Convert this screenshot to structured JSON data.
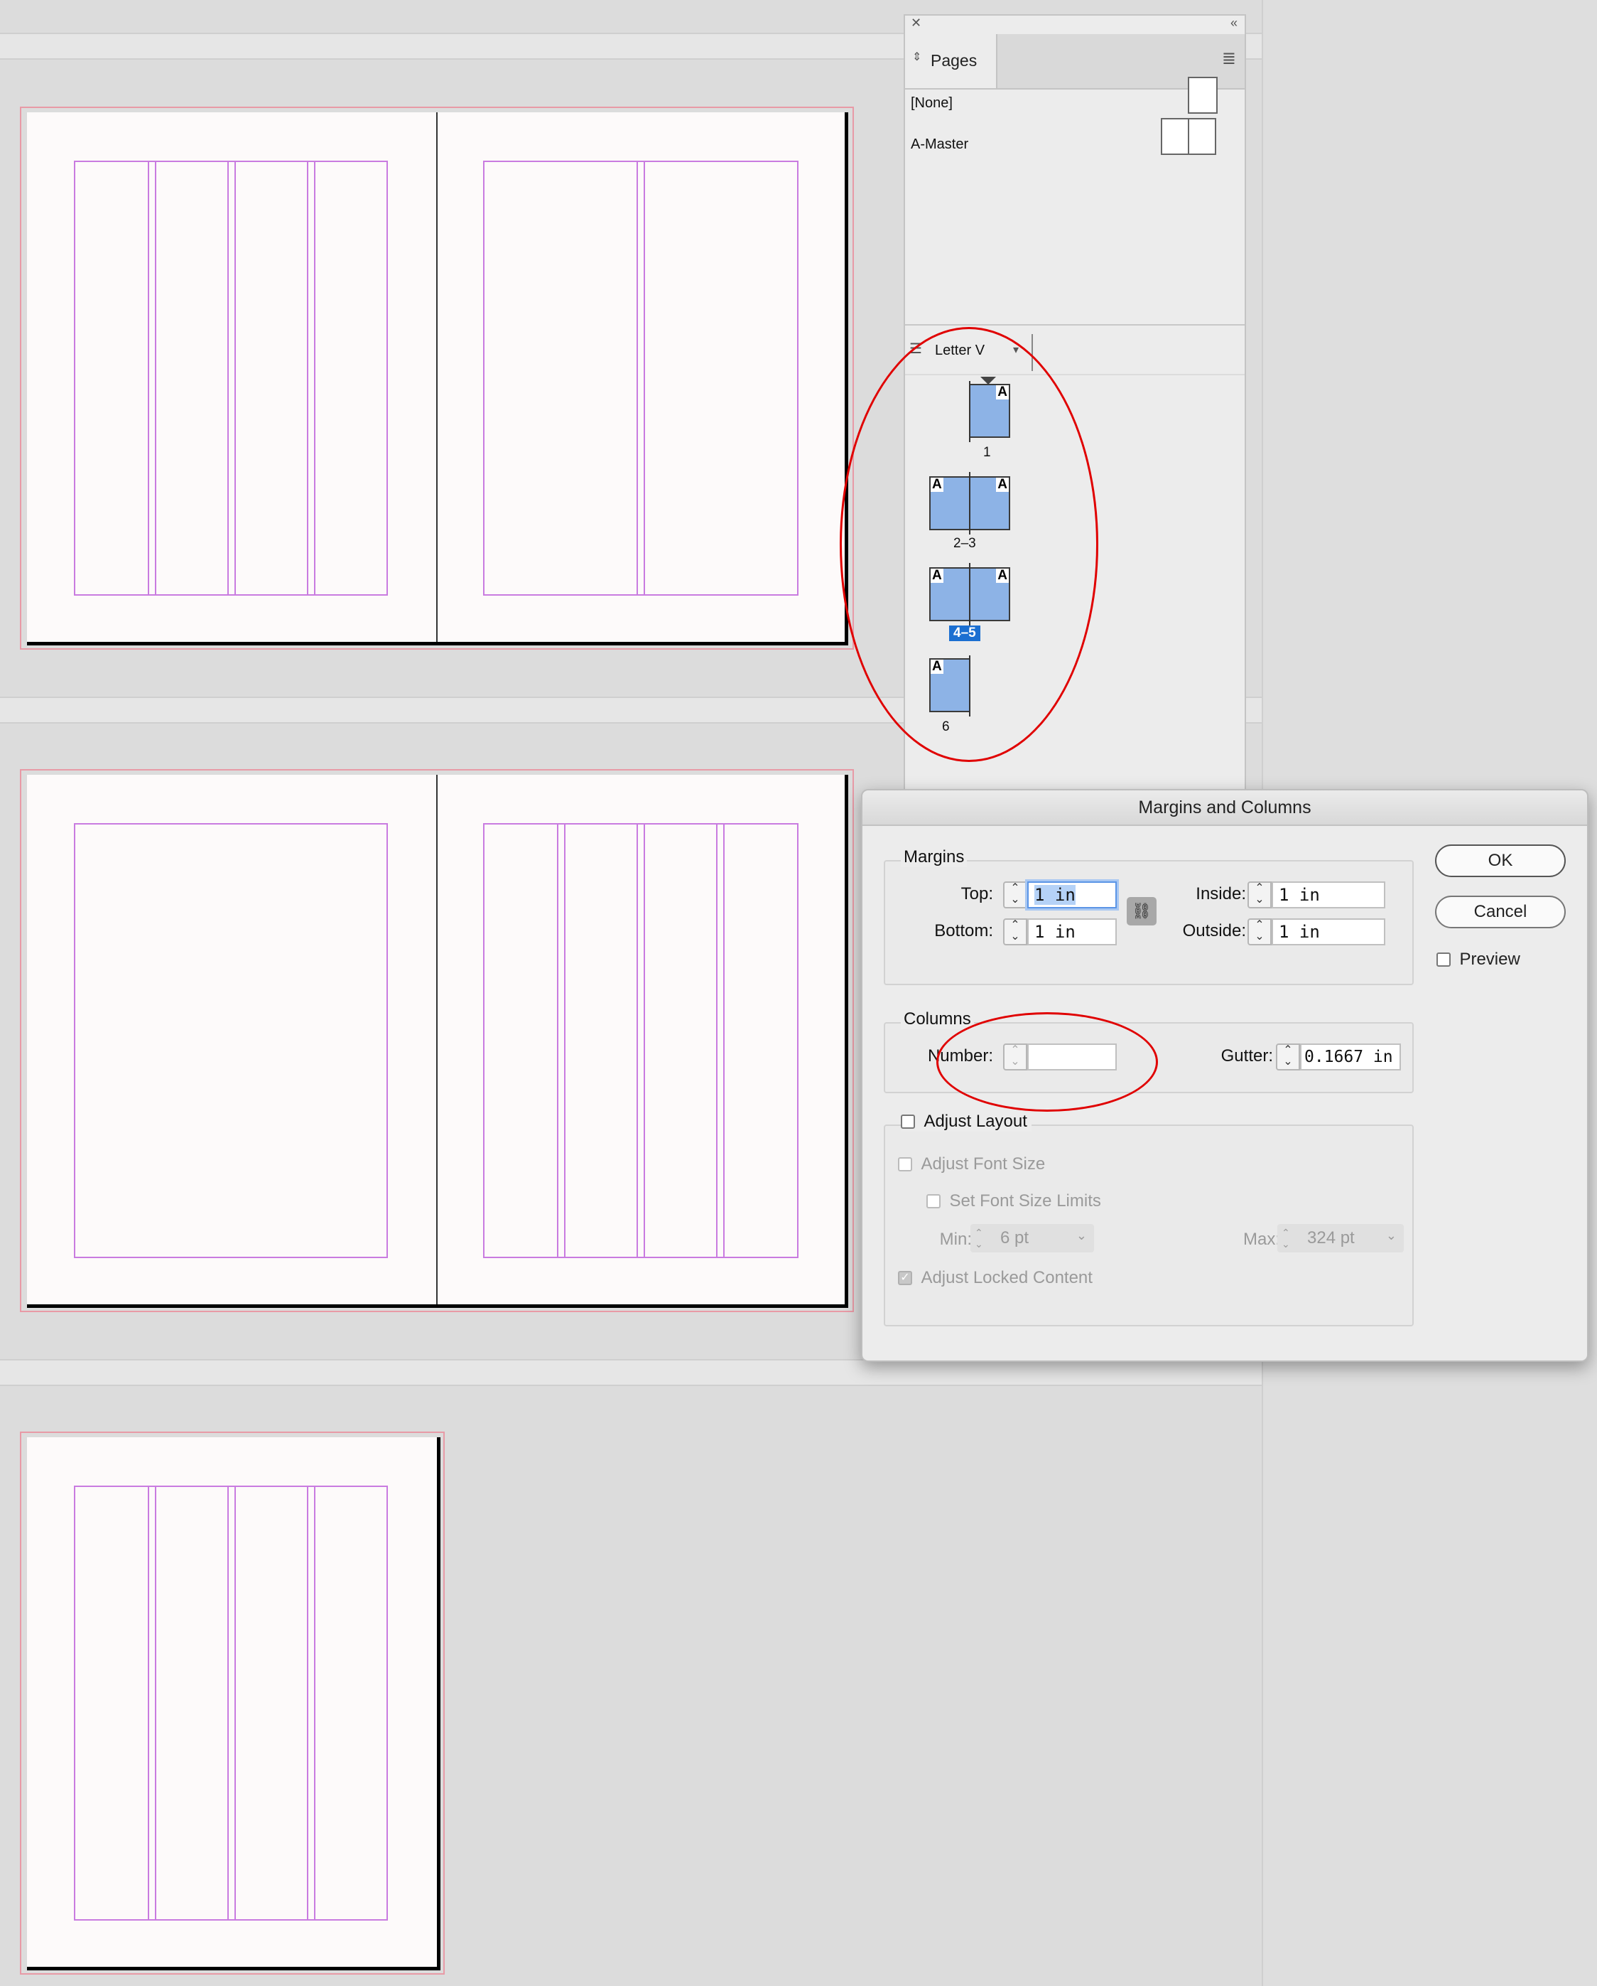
{
  "pages_panel": {
    "tab_label": "Pages",
    "masters": [
      {
        "label": "[None]"
      },
      {
        "label": "A-Master"
      }
    ],
    "page_size_label": "Letter V",
    "master_prefix": "A",
    "page_groups": [
      {
        "label": "1"
      },
      {
        "label": "2–3"
      },
      {
        "label": "4–5",
        "selected": true
      },
      {
        "label": "6"
      }
    ]
  },
  "dialog": {
    "title": "Margins and Columns",
    "margins_label": "Margins",
    "top_label": "Top:",
    "top_value": "1 in",
    "bottom_label": "Bottom:",
    "bottom_value": "1 in",
    "inside_label": "Inside:",
    "inside_value": "1 in",
    "outside_label": "Outside:",
    "outside_value": "1 in",
    "columns_label": "Columns",
    "number_label": "Number:",
    "number_value": "",
    "gutter_label": "Gutter:",
    "gutter_value": "0.1667 in",
    "adjust_layout_label": "Adjust Layout",
    "adjust_font_size_label": "Adjust Font Size",
    "set_font_size_limits_label": "Set Font Size Limits",
    "min_label": "Min:",
    "min_value": "6 pt",
    "max_label": "Max:",
    "max_value": "324 pt",
    "adjust_locked_label": "Adjust Locked Content",
    "ok_label": "OK",
    "cancel_label": "Cancel",
    "preview_label": "Preview"
  },
  "colors": {
    "guide": "#c97be0",
    "bleed": "#e89aa6",
    "page_thumb": "#8db3e6",
    "selection": "#1b6fd1",
    "annotation": "#e00000"
  }
}
